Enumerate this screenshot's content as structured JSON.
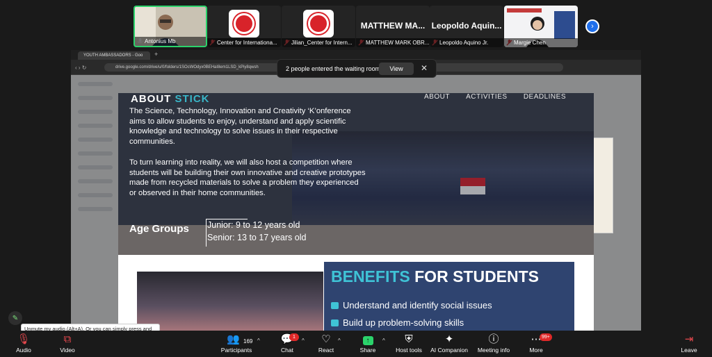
{
  "participants": [
    {
      "name": "Antonius Mb",
      "kind": "video",
      "active": true
    },
    {
      "name": "Center for Internationa...",
      "kind": "logo"
    },
    {
      "name": "Jilian_Center for Intern...",
      "kind": "logo"
    },
    {
      "name": "MATTHEW MARK OBR...",
      "display": "MATTHEW  MA...",
      "kind": "name"
    },
    {
      "name": "Leopoldo Aquino Jr.",
      "display": "Leopoldo  Aquin...",
      "kind": "name"
    },
    {
      "name": "Margie Chen",
      "kind": "video"
    }
  ],
  "browser": {
    "tab_title": "YOUTH AMBASSADORS - Goo",
    "url": "drive.google.com/drive/u/0/folders/1SOcWOdyx0BEHaI8em1LSD_kPiy8qwsh"
  },
  "notification": {
    "message": "2 people entered the waiting room",
    "view_label": "View",
    "close_label": "✕"
  },
  "document": {
    "about_prefix": "ABOUT ",
    "about_highlight": "STICK",
    "nav": [
      "ABOUT",
      "ACTIVITIES",
      "DEADLINES"
    ],
    "para1": "The Science, Technology, Innovation and Creativity ‘K’onference aims to allow students to enjoy, understand and apply scientific knowledge and technology to solve issues in their respective communities.",
    "para2": "To turn learning into reality, we will also host a competition where students will be building their own innovative and creative prototypes made from recycled materials to solve a problem they experienced or observed in their home communities.",
    "age_title": "Age Groups",
    "age_junior": "Junior: 9 to 12 years old",
    "age_senior": "Senior: 13 to 17 years old",
    "benefits_highlight": "BENEFITS",
    "benefits_rest": " FOR STUDENTS",
    "benefit_1": "Understand and identify social issues",
    "benefit_2": "Build up problem-solving skills"
  },
  "tooltip": "Unmute my audio (Alt+A). Or you can simply press and hold the Space bar to temporarily unmute.",
  "toolbar": {
    "audio": "Audio",
    "video": "Video",
    "participants": "Participants",
    "participants_count": "169",
    "chat": "Chat",
    "chat_badge": "1",
    "react": "React",
    "share": "Share",
    "host_tools": "Host tools",
    "ai_companion": "AI Companion",
    "meeting_info": "Meeting info",
    "more": "More",
    "more_badge": "99+",
    "leave": "Leave"
  },
  "colors": {
    "active_border": "#2bd36b",
    "accent_teal": "#3fc3d6",
    "benefits_bg": "#2f4470",
    "badge_red": "#e02828",
    "leave_red": "#e5484d"
  }
}
